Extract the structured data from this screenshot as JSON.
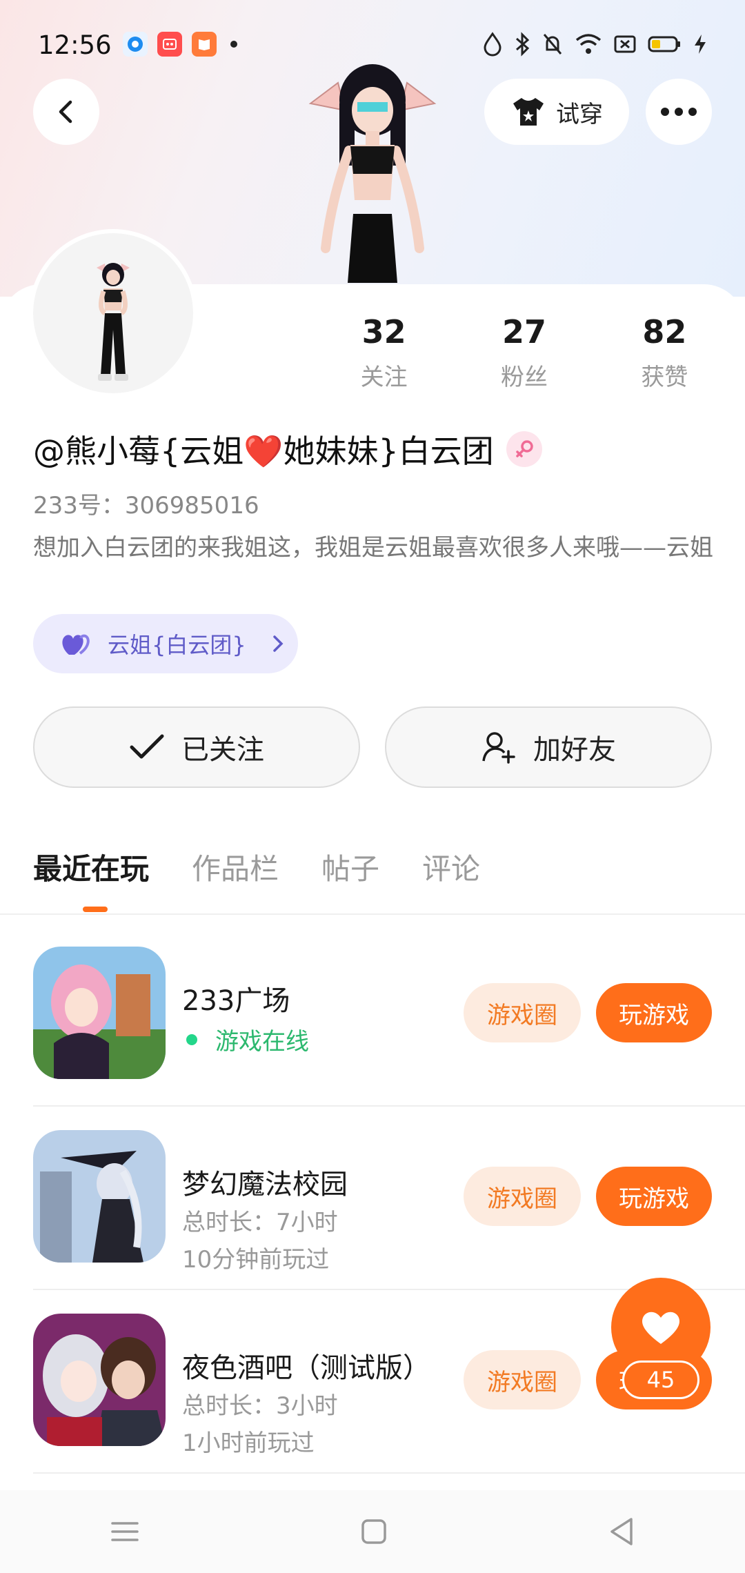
{
  "status_bar": {
    "time": "12:56",
    "battery_color": "#f5c400"
  },
  "header": {
    "back_icon": "chevron-left-icon",
    "tryon_label": "试穿",
    "more_icon": "more-horizontal-icon"
  },
  "profile": {
    "stats": [
      {
        "value": "32",
        "label": "关注"
      },
      {
        "value": "27",
        "label": "粉丝"
      },
      {
        "value": "82",
        "label": "获赞"
      }
    ],
    "username": "@熊小莓{云姐❤️她妹妹}白云团",
    "gender": "female",
    "uid_text": "233号：306985016",
    "bio": "想加入白云团的来我姐这，我姐是云姐最喜欢很多人来哦——云姐",
    "group_chip": "云姐{白云团}"
  },
  "actions": {
    "follow_label": "已关注",
    "add_friend_label": "加好友"
  },
  "tabs": [
    "最近在玩",
    "作品栏",
    "帖子",
    "评论"
  ],
  "games": [
    {
      "title": "233广场",
      "status": "游戏在线",
      "circle_label": "游戏圈",
      "play_label": "玩游戏"
    },
    {
      "title": "梦幻魔法校园",
      "duration": "总时长：7小时",
      "last_played": "10分钟前玩过",
      "circle_label": "游戏圈",
      "play_label": "玩游戏"
    },
    {
      "title": "夜色酒吧（测试版）",
      "duration": "总时长：3小时",
      "last_played": "1小时前玩过",
      "circle_label": "游戏圈",
      "play_label": "玩游戏"
    }
  ],
  "like_fab": {
    "count": "45"
  },
  "colors": {
    "accent": "#ff6e1a",
    "online": "#23d68a"
  }
}
